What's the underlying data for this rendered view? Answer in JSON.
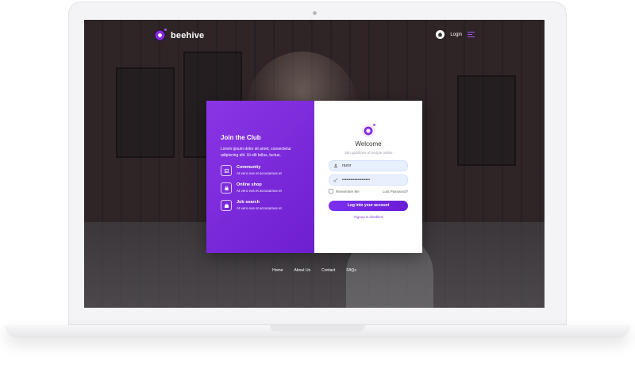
{
  "header": {
    "brand_name": "beehive",
    "login_label": "Login"
  },
  "join": {
    "title": "Join the Club",
    "description": "Lorem ipsum dolor sit amet, consectetur adipiscing elit. Ut elit tellus, luctus.",
    "features": [
      {
        "title": "Community",
        "subtitle": "At vero eos et accusamus et",
        "icon": "laptop-icon"
      },
      {
        "title": "Online shop",
        "subtitle": "At vero eos et accusamus et",
        "icon": "shopping-bag-icon"
      },
      {
        "title": "Job search",
        "subtitle": "At vero eos et accusamus et",
        "icon": "briefcase-icon"
      }
    ]
  },
  "login": {
    "title": "Welcome",
    "subtitle": "Join gazillions of people online",
    "username_value": "razor",
    "password_value": "••••••••••••••••••••",
    "remember_label": "Remember Me",
    "lost_password_label": "Lost Password?",
    "submit_label": "Log into your account",
    "signup_note": "Signup is disabled"
  },
  "footer": {
    "links": [
      "Home",
      "About Us",
      "Contact",
      "FAQs"
    ]
  },
  "colors": {
    "accent": "#7b2ff0",
    "panel_gradient_start": "#8a35e6",
    "panel_gradient_end": "#6d1fd0",
    "input_bg": "#e8f0fe"
  }
}
